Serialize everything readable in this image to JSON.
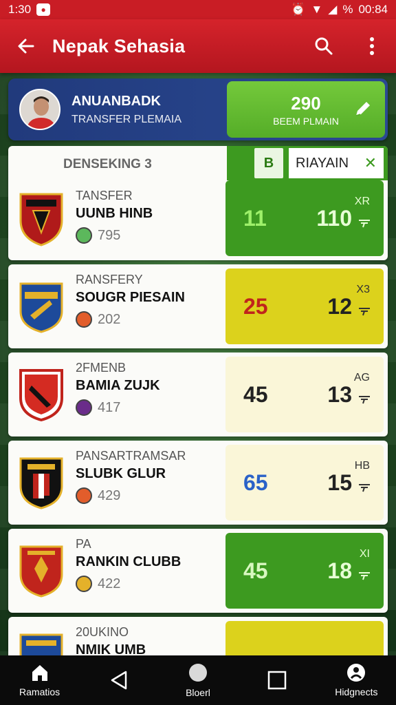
{
  "status": {
    "time": "1:30",
    "battery": "%",
    "clock": "00:84"
  },
  "app_bar": {
    "title": "Nepak Sehasia"
  },
  "player": {
    "name": "ANUANBADK",
    "subtitle": "TRANSFER PLEMAIA",
    "badge_value": "290",
    "badge_label": "BEEM PLMAIN"
  },
  "list_header": {
    "label": "DENSEKING 3",
    "tab_chip": "B",
    "tab_label": "RIAYAIN"
  },
  "colors": {
    "primary": "#c91d25",
    "green": "#55ad28",
    "yellow": "#dcd21c",
    "cream": "#faf6d8",
    "navy": "#213a7c"
  },
  "rows": [
    {
      "sub": "TANSFER",
      "name": "UUNB HINB",
      "meta": "795",
      "stat1": "11",
      "stat2": "110",
      "tag": "XR",
      "panel": "green",
      "s1color": "#9ef06a"
    },
    {
      "sub": "RANSFERY",
      "name": "SOUGR PIESAIN",
      "meta": "202",
      "stat1": "25",
      "stat2": "12",
      "tag": "X3",
      "panel": "yellow",
      "s1color": "#c0241c"
    },
    {
      "sub": "2FMENB",
      "name": "BAMIA ZUJK",
      "meta": "417",
      "stat1": "45",
      "stat2": "13",
      "tag": "AG",
      "panel": "cream",
      "s1color": "#222222"
    },
    {
      "sub": "PANSARTRAMSAR",
      "name": "SLUBK GLUR",
      "meta": "429",
      "stat1": "65",
      "stat2": "15",
      "tag": "HB",
      "panel": "cream",
      "s1color": "#2a62c8"
    },
    {
      "sub": "PA",
      "name": "RANKIN CLUBB",
      "meta": "422",
      "stat1": "45",
      "stat2": "18",
      "tag": "XI",
      "panel": "green",
      "s1color": "#d8f7c0"
    },
    {
      "sub": "20UKINO",
      "name": "NMIK UMB",
      "meta": "",
      "stat1": "",
      "stat2": "",
      "tag": "",
      "panel": "yellow",
      "s1color": "#c0241c"
    }
  ],
  "nav": [
    {
      "label": "Ramatios",
      "icon": "home-icon"
    },
    {
      "label": "",
      "icon": "back-triangle-icon"
    },
    {
      "label": "Bloerl",
      "icon": "circle-icon"
    },
    {
      "label": "",
      "icon": "square-icon"
    },
    {
      "label": "Hidgnects",
      "icon": "profile-icon"
    }
  ]
}
